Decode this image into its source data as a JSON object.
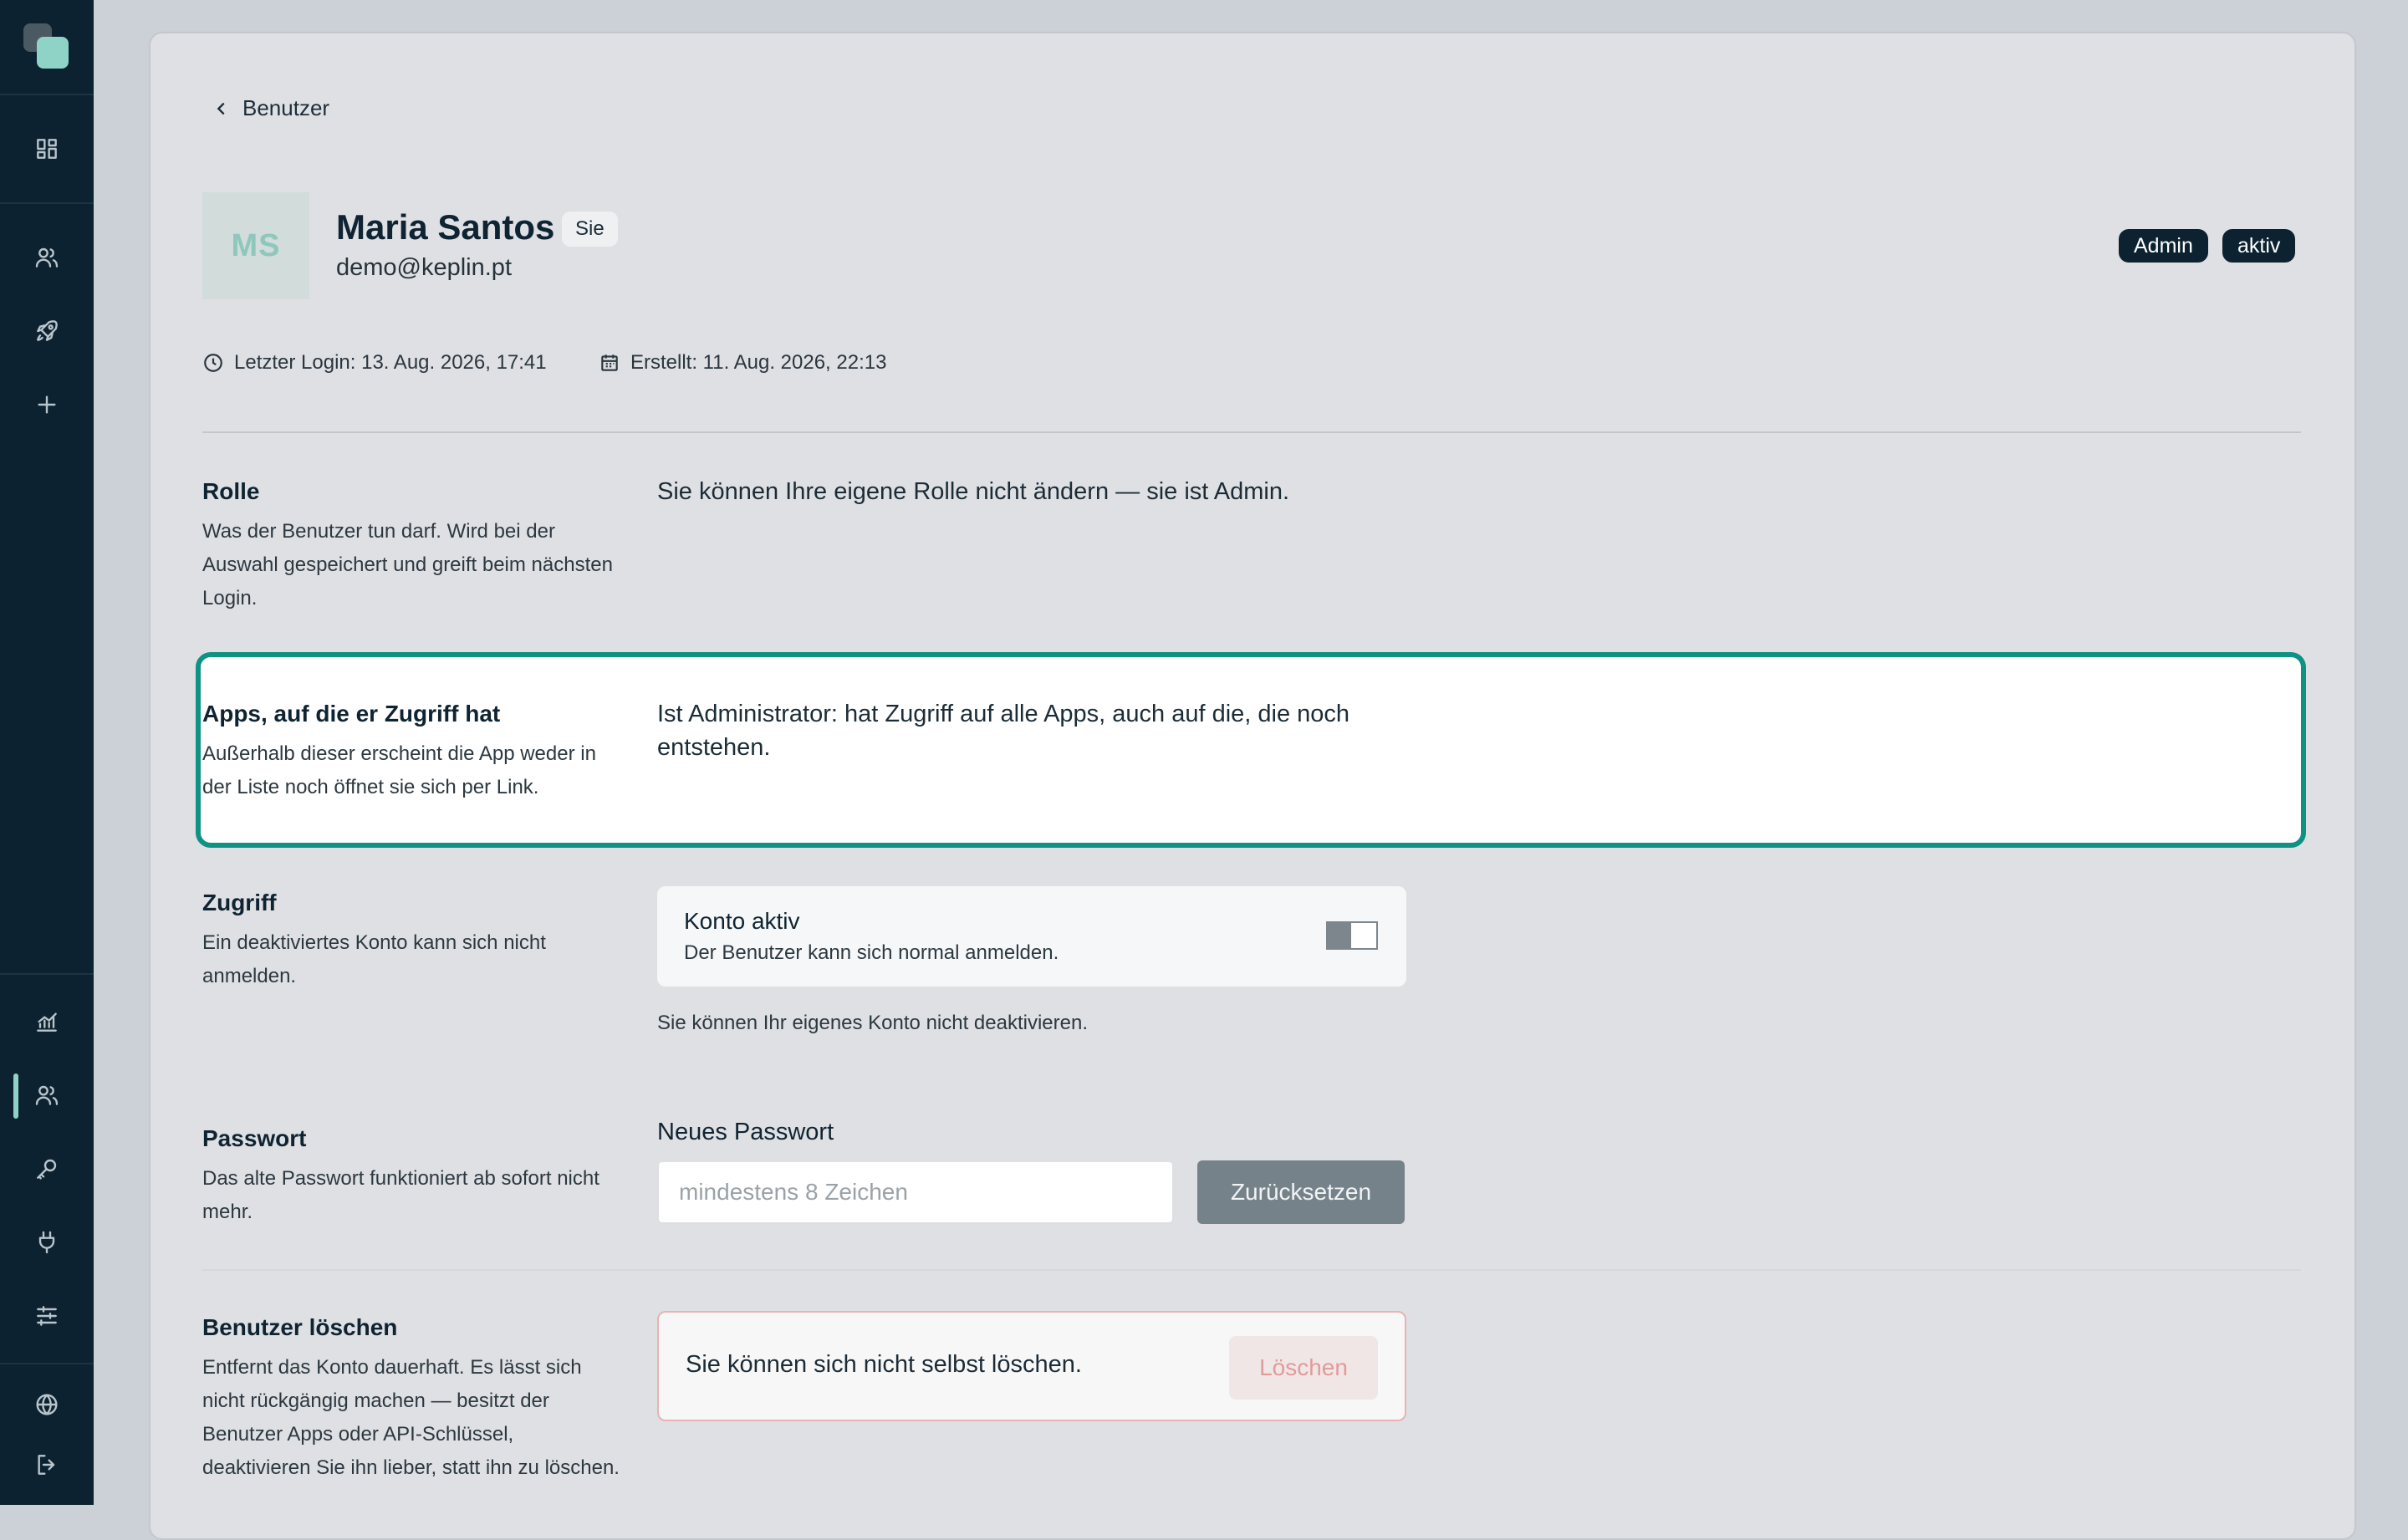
{
  "sidebar": {
    "top_icons": [
      "dashboard-icon",
      "users-icon",
      "rocket-icon",
      "plus-icon"
    ],
    "bottom_icons": [
      "chart-icon",
      "users-icon",
      "key-icon",
      "plug-icon",
      "sliders-icon",
      "globe-icon",
      "logout-icon"
    ],
    "active": "users",
    "accent": "#8fd3c6"
  },
  "breadcrumb": {
    "back_label": "Benutzer"
  },
  "user": {
    "initials": "MS",
    "name": "Maria Santos",
    "you_badge": "Sie",
    "email": "demo@keplin.pt",
    "role_pill": "Admin",
    "status_pill": "aktiv"
  },
  "meta": {
    "last_login": "Letzter Login: 13. Aug. 2026, 17:41",
    "created": "Erstellt: 11. Aug. 2026, 22:13"
  },
  "sections": {
    "role": {
      "title": "Rolle",
      "desc": "Was der Benutzer tun darf. Wird bei der Auswahl gespeichert und greift beim nächsten Login.",
      "value": "Sie können Ihre eigene Rolle nicht ändern — sie ist Admin."
    },
    "apps": {
      "title": "Apps, auf die er Zugriff hat",
      "desc": "Außerhalb dieser erscheint die App weder in der Liste noch öffnet sie sich per Link.",
      "value": "Ist Administrator: hat Zugriff auf alle Apps, auch auf die, die noch entstehen."
    },
    "access": {
      "title": "Zugriff",
      "desc": "Ein deaktiviertes Konto kann sich nicht anmelden.",
      "toggle_title": "Konto aktiv",
      "toggle_sub": "Der Benutzer kann sich normal anmelden.",
      "note": "Sie können Ihr eigenes Konto nicht deaktivieren."
    },
    "password": {
      "title": "Passwort",
      "desc": "Das alte Passwort funktioniert ab sofort nicht mehr.",
      "label": "Neues Passwort",
      "placeholder": "mindestens 8 Zeichen",
      "value": "",
      "button": "Zurücksetzen"
    },
    "delete": {
      "title": "Benutzer löschen",
      "desc": "Entfernt das Konto dauerhaft. Es lässt sich nicht rückgängig machen — besitzt der Benutzer Apps oder API-Schlüssel, deaktivieren Sie ihn lieber, statt ihn zu löschen.",
      "message": "Sie können sich nicht selbst löschen.",
      "button": "Löschen"
    }
  },
  "colors": {
    "sidebar_bg": "#0c2230",
    "highlight_border": "#0f9183",
    "danger_border": "#e7b3b3",
    "danger_text": "#e29a9a"
  }
}
